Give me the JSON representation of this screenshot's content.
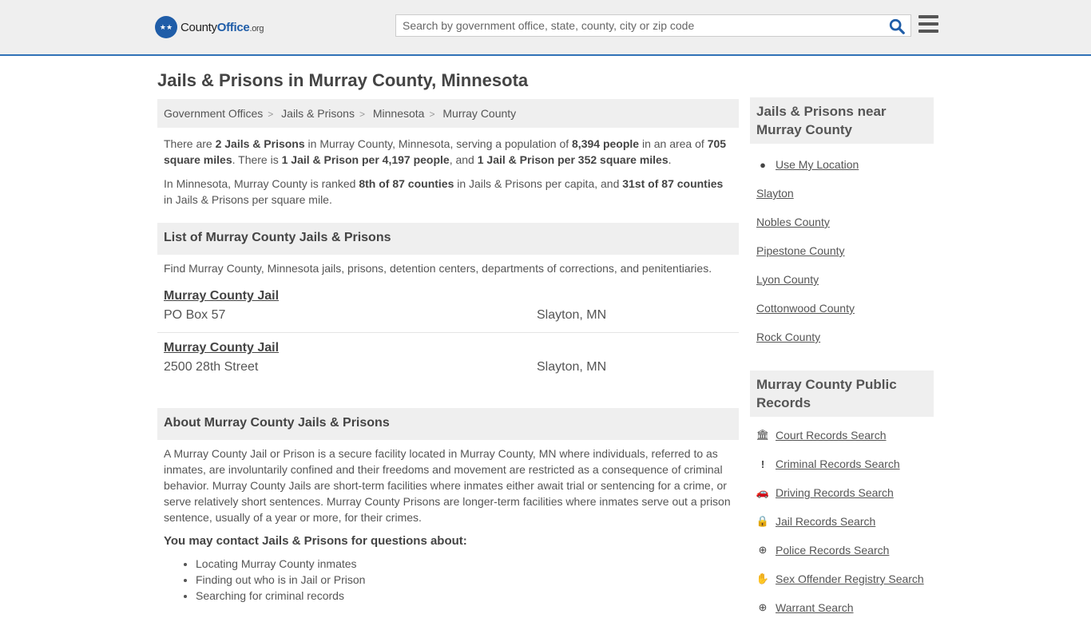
{
  "header": {
    "logo": {
      "part1": "County",
      "part2": "Office",
      "part3": ".org"
    },
    "search_placeholder": "Search by government office, state, county, city or zip code"
  },
  "page_title": "Jails & Prisons in Murray County, Minnesota",
  "breadcrumb": [
    "Government Offices",
    "Jails & Prisons",
    "Minnesota",
    "Murray County"
  ],
  "intro": {
    "p1": [
      {
        "t": "There are ",
        "b": false
      },
      {
        "t": "2 Jails & Prisons",
        "b": true
      },
      {
        "t": " in Murray County, Minnesota, serving a population of ",
        "b": false
      },
      {
        "t": "8,394 people",
        "b": true
      },
      {
        "t": " in an area of ",
        "b": false
      },
      {
        "t": "705 square miles",
        "b": true
      },
      {
        "t": ". There is ",
        "b": false
      },
      {
        "t": "1 Jail & Prison per 4,197 people",
        "b": true
      },
      {
        "t": ", and ",
        "b": false
      },
      {
        "t": "1 Jail & Prison per 352 square miles",
        "b": true
      },
      {
        "t": ".",
        "b": false
      }
    ],
    "p2": [
      {
        "t": "In Minnesota, Murray County is ranked ",
        "b": false
      },
      {
        "t": "8th of 87 counties",
        "b": true
      },
      {
        "t": " in Jails & Prisons per capita, and ",
        "b": false
      },
      {
        "t": "31st of 87 counties",
        "b": true
      },
      {
        "t": " in Jails & Prisons per square mile.",
        "b": false
      }
    ]
  },
  "list_section": {
    "title": "List of Murray County Jails & Prisons",
    "description": "Find Murray County, Minnesota jails, prisons, detention centers, departments of corrections, and penitentiaries.",
    "entries": [
      {
        "name": "Murray County Jail",
        "address": "PO Box 57",
        "city": "Slayton, MN"
      },
      {
        "name": "Murray County Jail",
        "address": "2500 28th Street",
        "city": "Slayton, MN"
      }
    ]
  },
  "about_section": {
    "title": "About Murray County Jails & Prisons",
    "body": "A Murray County Jail or Prison is a secure facility located in Murray County, MN where individuals, referred to as inmates, are involuntarily confined and their freedoms and movement are restricted as a consequence of criminal behavior. Murray County Jails are short-term facilities where inmates either await trial or sentencing for a crime, or serve relatively short sentences. Murray County Prisons are longer-term facilities where inmates serve out a prison sentence, usually of a year or more, for their crimes.",
    "contact_heading": "You may contact Jails & Prisons for questions about:",
    "bullets": [
      "Locating Murray County inmates",
      "Finding out who is in Jail or Prison",
      "Searching for criminal records"
    ]
  },
  "sidebar": {
    "nearby_title": "Jails & Prisons near Murray County",
    "use_location": "Use My Location",
    "nearby": [
      "Slayton",
      "Nobles County",
      "Pipestone County",
      "Lyon County",
      "Cottonwood County",
      "Rock County"
    ],
    "records_title": "Murray County Public Records",
    "records": [
      {
        "label": "Court Records Search",
        "icon": "courthouse-icon"
      },
      {
        "label": "Criminal Records Search",
        "icon": "exclamation-icon"
      },
      {
        "label": "Driving Records Search",
        "icon": "car-icon"
      },
      {
        "label": "Jail Records Search",
        "icon": "lock-icon"
      },
      {
        "label": "Police Records Search",
        "icon": "crosshair-icon"
      },
      {
        "label": "Sex Offender Registry Search",
        "icon": "hand-icon"
      },
      {
        "label": "Warrant Search",
        "icon": "plus-circle-icon"
      }
    ]
  }
}
